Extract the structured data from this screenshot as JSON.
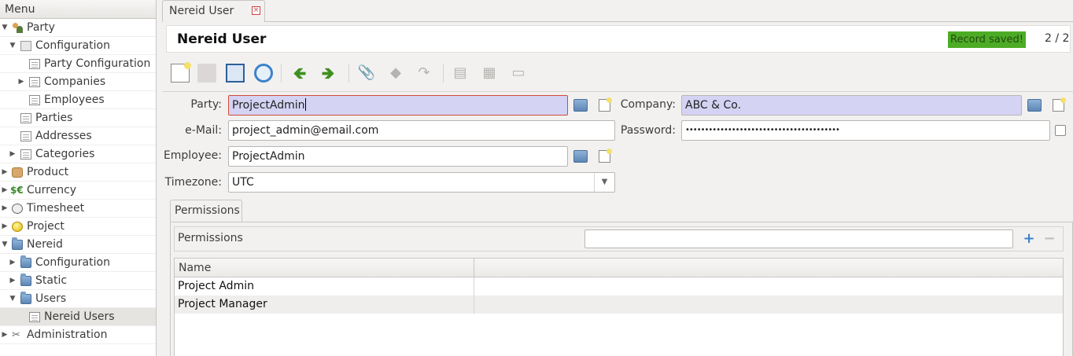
{
  "menu": {
    "header": "Menu",
    "items": [
      {
        "label": "Party",
        "icon": "party-icon"
      },
      {
        "label": "Configuration",
        "icon": "configuration-icon"
      },
      {
        "label": "Party Configuration",
        "icon": "document-icon"
      },
      {
        "label": "Companies",
        "icon": "document-icon"
      },
      {
        "label": "Employees",
        "icon": "document-icon"
      },
      {
        "label": "Parties",
        "icon": "document-icon"
      },
      {
        "label": "Addresses",
        "icon": "document-icon"
      },
      {
        "label": "Categories",
        "icon": "document-icon"
      },
      {
        "label": "Product",
        "icon": "product-icon"
      },
      {
        "label": "Currency",
        "icon": "currency-icon"
      },
      {
        "label": "Timesheet",
        "icon": "clock-icon"
      },
      {
        "label": "Project",
        "icon": "project-icon"
      },
      {
        "label": "Nereid",
        "icon": "folder-icon"
      },
      {
        "label": "Configuration",
        "icon": "folder-icon"
      },
      {
        "label": "Static",
        "icon": "folder-icon"
      },
      {
        "label": "Users",
        "icon": "folder-icon"
      },
      {
        "label": "Nereid Users",
        "icon": "document-icon"
      },
      {
        "label": "Administration",
        "icon": "tools-icon"
      }
    ]
  },
  "tab": {
    "label": "Nereid User",
    "close_glyph": "×"
  },
  "header": {
    "title": "Nereid User",
    "status": "Record saved!",
    "counter": "2 / 2",
    "status_color": "#4dac26"
  },
  "form": {
    "party_label": "Party:",
    "party_value": "ProjectAdmin",
    "company_label": "Company:",
    "company_value": "ABC & Co.",
    "email_label": "e-Mail:",
    "email_value": "project_admin@email.com",
    "password_label": "Password:",
    "password_value": "••••••••••••••••••••••••••••••••••••••••",
    "employee_label": "Employee:",
    "employee_value": "ProjectAdmin",
    "timezone_label": "Timezone:",
    "timezone_value": "UTC"
  },
  "permissions": {
    "tab_label": "Permissions",
    "title": "Permissions",
    "add_glyph": "+",
    "remove_glyph": "−",
    "column_name": "Name",
    "rows": [
      "Project Admin",
      "Project Manager"
    ]
  },
  "toolbar": {
    "prev_glyph": "🡸",
    "next_glyph": "🡺",
    "attach_glyph": "📎",
    "action_glyph": "◆",
    "relate_glyph": "↷",
    "report_glyph": "▤",
    "email_glyph": "▦",
    "print_glyph": "▭"
  }
}
